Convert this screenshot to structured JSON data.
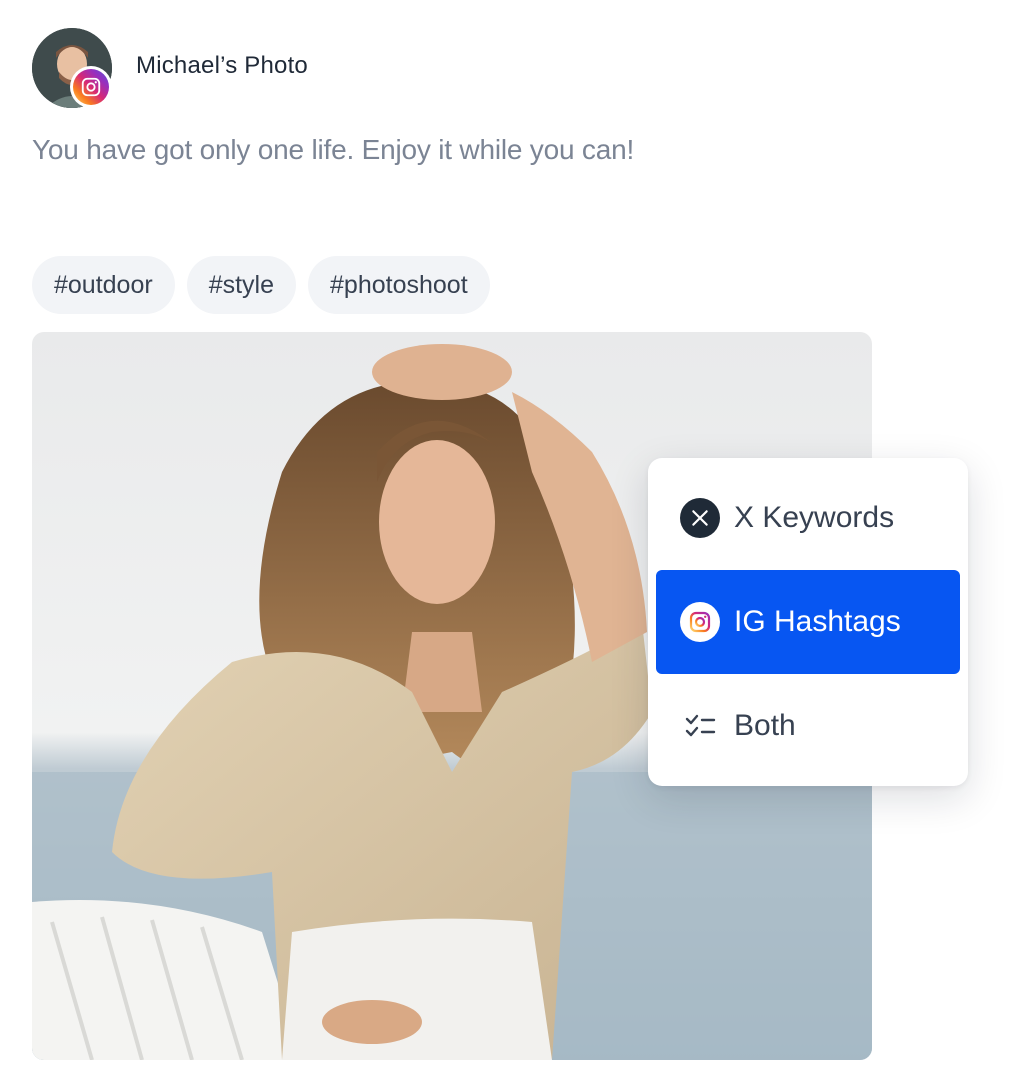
{
  "post": {
    "author": "Michael’s Photo",
    "caption": "You have got only one life. Enjoy it while you can!",
    "tags": [
      "#outdoor",
      "#style",
      "#photoshoot"
    ]
  },
  "menu": {
    "items": [
      {
        "label": "X Keywords",
        "icon": "x-logo-icon",
        "active": false
      },
      {
        "label": "IG Hashtags",
        "icon": "instagram-icon",
        "active": true
      },
      {
        "label": "Both",
        "icon": "checklist-icon",
        "active": false
      }
    ]
  },
  "colors": {
    "accent": "#0756f2",
    "tag_bg": "#f2f4f7",
    "caption": "#7b8494"
  }
}
